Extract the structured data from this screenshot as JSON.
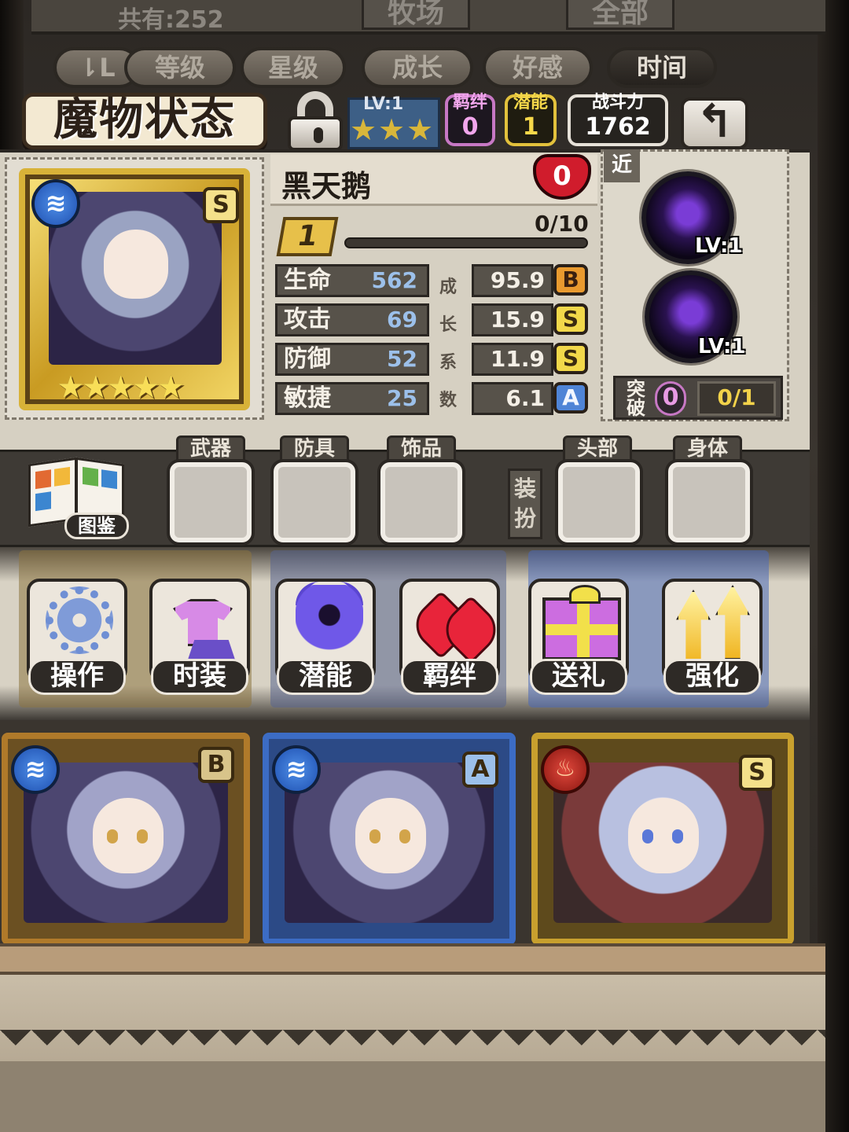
{
  "top_bar": {
    "total_count": "共有:252",
    "tab_left": "牧场",
    "tab_right": "全部"
  },
  "sort_tabs": [
    {
      "label": "⇂L",
      "active": true
    },
    {
      "label": "等级",
      "active": false
    },
    {
      "label": "星级",
      "active": false
    },
    {
      "label": "成长",
      "active": false
    },
    {
      "label": "好感",
      "active": false
    },
    {
      "label": "时间",
      "active": true
    }
  ],
  "header": {
    "title": "魔物状态",
    "lock_icon": "unlocked-padlock-icon",
    "level_label": "LV:1",
    "bond_label": "羁绊",
    "bond_value": "0",
    "potential_label": "潜能",
    "potential_value": "1",
    "power_label": "战斗力",
    "power_value": "1762",
    "back_icon": "return-arrow-icon"
  },
  "monster": {
    "name": "黑天鹅",
    "affection": "0",
    "element_icon": "water-element-icon",
    "rank": "S",
    "stars": "★★★★★",
    "level": "1",
    "exp_text": "0/10",
    "exp_fraction": 0.0
  },
  "stats": [
    {
      "name": "生命",
      "value": "562",
      "growth": "95.9",
      "grade": "B"
    },
    {
      "name": "攻击",
      "value": "69",
      "growth": "15.9",
      "grade": "S"
    },
    {
      "name": "防御",
      "value": "52",
      "growth": "11.9",
      "grade": "S"
    },
    {
      "name": "敏捷",
      "value": "25",
      "growth": "6.1",
      "grade": "A"
    }
  ],
  "growth_label": [
    "成",
    "长",
    "系",
    "数"
  ],
  "skills": {
    "range_label": "近",
    "skill1_level": "LV:1",
    "skill2_level": "LV:1",
    "breakthrough_label": "突破",
    "breakthrough_count": "0",
    "breakthrough_progress": "0/1"
  },
  "equipment": {
    "book_label": "图鉴",
    "slots": [
      "武器",
      "防具",
      "饰品"
    ],
    "dress_label": "装扮",
    "dress_slots": [
      "头部",
      "身体"
    ]
  },
  "actions": [
    {
      "label": "操作",
      "icon": "gear-icon"
    },
    {
      "label": "时装",
      "icon": "outfit-icon"
    },
    {
      "label": "潜能",
      "icon": "demon-icon"
    },
    {
      "label": "羁绊",
      "icon": "hearts-icon"
    },
    {
      "label": "送礼",
      "icon": "gift-icon"
    },
    {
      "label": "强化",
      "icon": "upgrade-arrows-icon"
    }
  ],
  "roster": [
    {
      "element": "water",
      "rank": "B"
    },
    {
      "element": "water",
      "rank": "A"
    },
    {
      "element": "fire",
      "rank": "S"
    }
  ],
  "colors": {
    "grade_B": "#e99a2f",
    "grade_S": "#f2d84a",
    "grade_A": "#4f84d6",
    "bond_pink": "#c778c4",
    "potential_gold": "#e2c13c"
  }
}
